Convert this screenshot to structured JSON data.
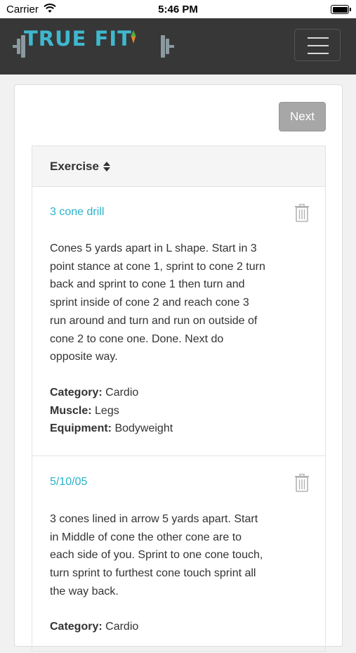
{
  "status_bar": {
    "carrier": "Carrier",
    "time": "5:46 PM"
  },
  "navbar": {
    "logo_text": "TRUE FIT"
  },
  "controls": {
    "next_label": "Next"
  },
  "table": {
    "column_header": "Exercise",
    "rows": [
      {
        "name": "3 cone drill",
        "description": "Cones 5 yards apart in L shape. Start in 3 point stance at cone 1, sprint to cone 2 turn back and sprint to cone 1 then turn and sprint inside of cone 2 and reach cone 3 run around and turn and run on outside of cone 2 to cone one. Done. Next do opposite way.",
        "category_label": "Category:",
        "category": "Cardio",
        "muscle_label": "Muscle:",
        "muscle": "Legs",
        "equipment_label": "Equipment:",
        "equipment": "Bodyweight"
      },
      {
        "name": "5/10/05",
        "description": "3 cones lined in arrow 5 yards apart. Start in Middle of cone the other cone are to each side of you. Sprint to one cone touch, turn sprint to furthest cone touch sprint all the way back.",
        "category_label": "Category:",
        "category": "Cardio"
      }
    ]
  },
  "colors": {
    "navbar_bg": "#373737",
    "brand": "#3fb8cf",
    "link": "#2bb1c9",
    "next_disabled": "#a7a7a7"
  },
  "icons": {
    "wifi": "wifi-icon",
    "battery": "battery-icon",
    "menu": "hamburger-menu-icon",
    "sort": "sort-icon",
    "delete": "trash-icon",
    "logo_dumbbell": "dumbbell-icon",
    "logo_carrot": "carrot-icon"
  }
}
